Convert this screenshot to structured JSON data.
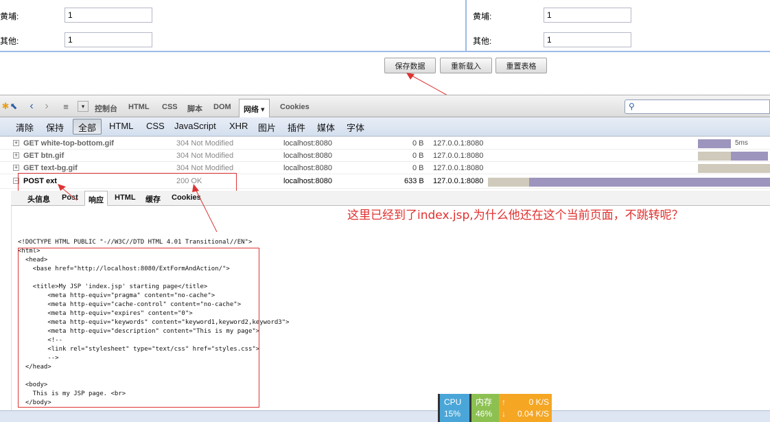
{
  "form": {
    "left_label_1": "黄埔:",
    "left_value_1": "1",
    "left_label_2": "其他:",
    "left_value_2": "1",
    "right_label_1": "黄埔:",
    "right_value_1": "1",
    "right_label_2": "其他:",
    "right_value_2": "1"
  },
  "buttons": {
    "save": "保存数据",
    "reload": "重新载入",
    "reset": "重置表格"
  },
  "firebug": {
    "tabs": [
      "控制台",
      "HTML",
      "CSS",
      "脚本",
      "DOM",
      "网络 ▾",
      "Cookies"
    ],
    "active_tab": "网络 ▾"
  },
  "net_filter": {
    "items": [
      "清除",
      "保持",
      "全部",
      "HTML",
      "CSS",
      "JavaScript",
      "XHR",
      "图片",
      "插件",
      "媒体",
      "字体"
    ],
    "active": "全部"
  },
  "requests": [
    {
      "url": "GET white-top-bottom.gif",
      "status": "304 Not Modified",
      "domain": "localhost:8080",
      "size": "0 B",
      "remote_ip": "127.0.0.1:8080",
      "timing_label": "5ms",
      "expander": "+"
    },
    {
      "url": "GET btn.gif",
      "status": "304 Not Modified",
      "domain": "localhost:8080",
      "size": "0 B",
      "remote_ip": "127.0.0.1:8080",
      "timing_label": "",
      "expander": "+"
    },
    {
      "url": "GET text-bg.gif",
      "status": "304 Not Modified",
      "domain": "localhost:8080",
      "size": "0 B",
      "remote_ip": "127.0.0.1:8080",
      "timing_label": "",
      "expander": "+"
    },
    {
      "url": "POST ext",
      "status": "200 OK",
      "domain": "localhost:8080",
      "size": "633 B",
      "remote_ip": "127.0.0.1:8080",
      "timing_label": "",
      "expander": "−"
    }
  ],
  "response_tabs": [
    "头信息",
    "Post",
    "响应",
    "HTML",
    "缓存",
    "Cookies"
  ],
  "active_response_tab": "响应",
  "response_code": "<!DOCTYPE HTML PUBLIC \"-//W3C//DTD HTML 4.01 Transitional//EN\">\n<html>\n  <head>\n    <base href=\"http://localhost:8080/ExtFormAndAction/\">\n\n    <title>My JSP 'index.jsp' starting page</title>\n        <meta http-equiv=\"pragma\" content=\"no-cache\">\n        <meta http-equiv=\"cache-control\" content=\"no-cache\">\n        <meta http-equiv=\"expires\" content=\"0\">\n        <meta http-equiv=\"keywords\" content=\"keyword1,keyword2,keyword3\">\n        <meta http-equiv=\"description\" content=\"This is my page\">\n        <!--\n        <link rel=\"stylesheet\" type=\"text/css\" href=\"styles.css\">\n        -->\n  </head>\n\n  <body>\n    This is my JSP page. <br>\n  </body>",
  "annotation": "这里已经到了index.jsp,为什么他还在这个当前页面，不跳转呢？",
  "sys_monitor": {
    "cpu_label": "CPU",
    "cpu_value": "15%",
    "mem_label": "内存",
    "mem_value": "46%",
    "up_value": "0 K/S",
    "down_value": "0.04 K/S",
    "up_icon": "↑",
    "down_icon": "↓"
  },
  "colors": {
    "annotation_red": "#e0302e",
    "timing_bar": "#9d95bd",
    "cpu_bg": "#4aa6d8",
    "mem_bg": "#8cc152",
    "net_bg": "#f5a623"
  }
}
